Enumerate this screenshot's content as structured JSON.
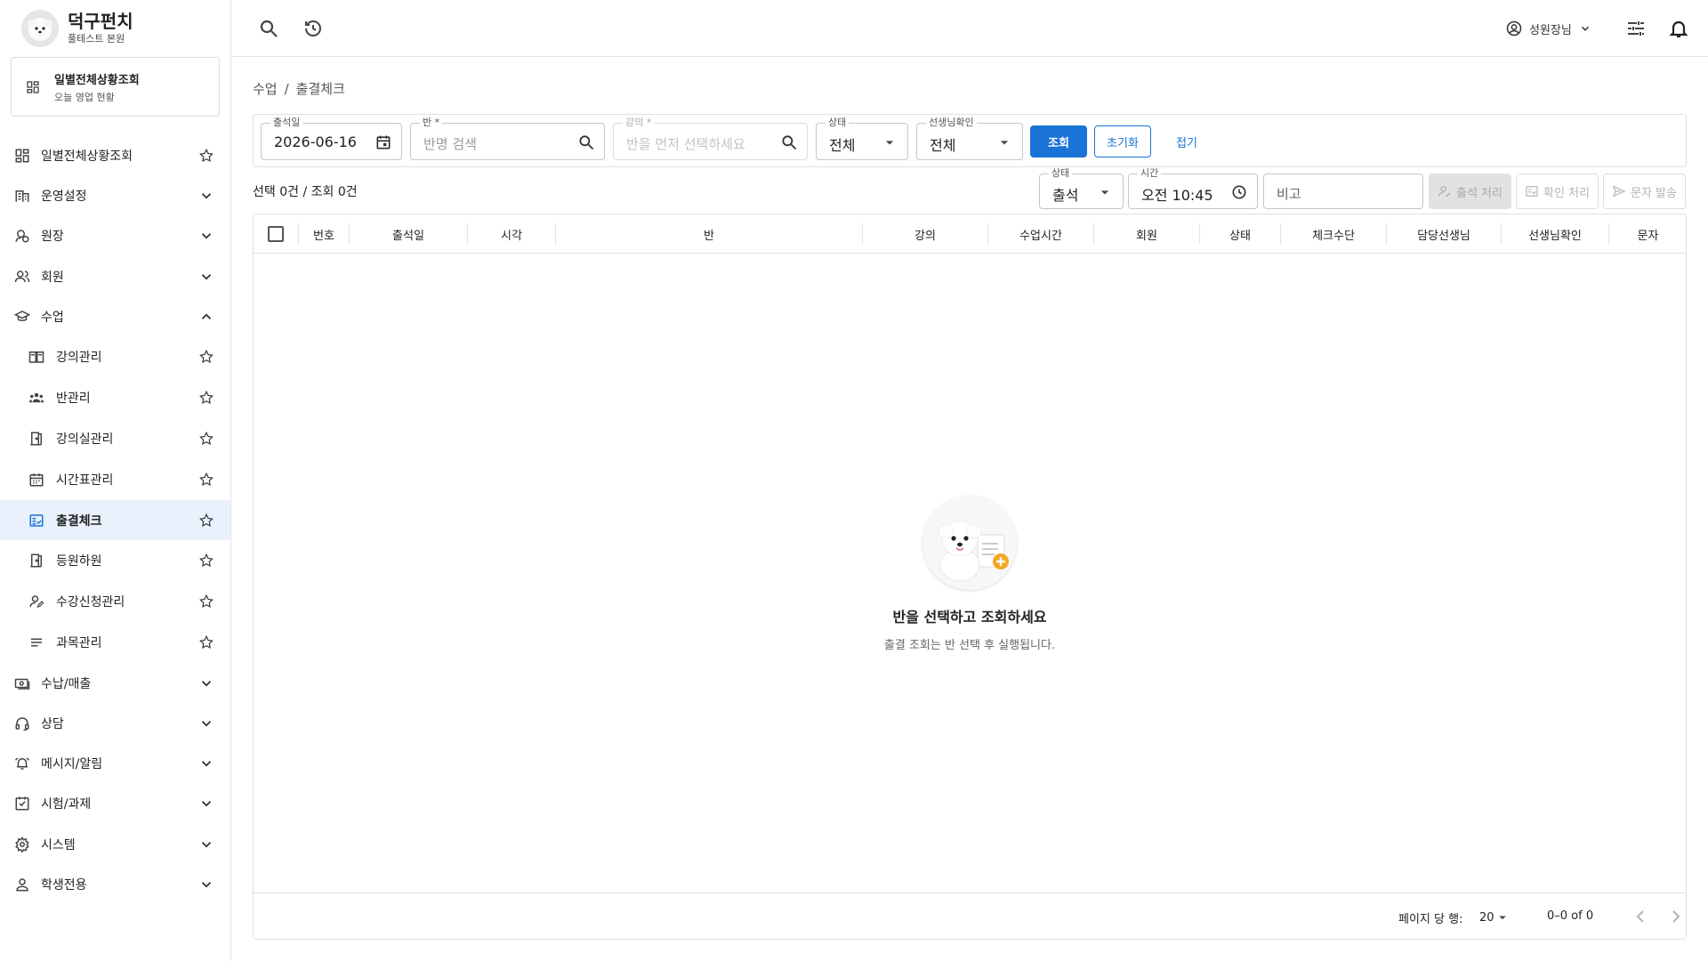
{
  "brand": {
    "name": "덕구펀치",
    "branch": "풀테스트 본원"
  },
  "today_card": {
    "title": "일별전체상황조회",
    "subtitle": "오늘 영업 현황"
  },
  "sidebar": {
    "items": [
      {
        "label": "일별전체상황조회",
        "icon": "dashboard-icon",
        "right": "star"
      },
      {
        "label": "운영설정",
        "icon": "building-icon",
        "right": "chevron-down"
      },
      {
        "label": "원장",
        "icon": "owner-icon",
        "right": "chevron-down"
      },
      {
        "label": "회원",
        "icon": "people-icon",
        "right": "chevron-down"
      },
      {
        "label": "수업",
        "icon": "graduation-cap-icon",
        "right": "chevron-up"
      },
      {
        "label": "강의관리",
        "icon": "book-icon",
        "right": "star",
        "sub": true
      },
      {
        "label": "반관리",
        "icon": "group-icon",
        "right": "star",
        "sub": true
      },
      {
        "label": "강의실관리",
        "icon": "door-icon",
        "right": "star",
        "sub": true
      },
      {
        "label": "시간표관리",
        "icon": "calendar-icon",
        "right": "star",
        "sub": true
      },
      {
        "label": "출결체크",
        "icon": "fact-check-icon",
        "right": "star",
        "sub": true,
        "active": true
      },
      {
        "label": "등원하원",
        "icon": "door-icon",
        "right": "star",
        "sub": true
      },
      {
        "label": "수강신청관리",
        "icon": "person-edit-icon",
        "right": "star",
        "sub": true
      },
      {
        "label": "과목관리",
        "icon": "list-icon",
        "right": "star",
        "sub": true
      },
      {
        "label": "수납/매출",
        "icon": "payments-icon",
        "right": "chevron-down"
      },
      {
        "label": "상담",
        "icon": "headset-icon",
        "right": "chevron-down"
      },
      {
        "label": "메시지/알림",
        "icon": "alarm-icon",
        "right": "chevron-down"
      },
      {
        "label": "시험/과제",
        "icon": "checkbox-icon",
        "right": "chevron-down"
      },
      {
        "label": "시스템",
        "icon": "gear-icon",
        "right": "chevron-down"
      },
      {
        "label": "학생전용",
        "icon": "person-icon",
        "right": "chevron-down"
      }
    ]
  },
  "topbar": {
    "user_label": "성원장님"
  },
  "breadcrumb": {
    "parent": "수업",
    "separator": "/",
    "current": "출결체크"
  },
  "filters": {
    "date": {
      "label": "출석일",
      "value": "2026-06-16"
    },
    "class": {
      "label": "반 *",
      "placeholder": "반명 검색"
    },
    "lecture": {
      "label": "강의 *",
      "placeholder": "반을 먼저 선택하세요"
    },
    "status": {
      "label": "상태",
      "value": "전체"
    },
    "teacher_check": {
      "label": "선생님확인",
      "value": "전체"
    },
    "search_button": "조회",
    "reset_button": "초기화",
    "collapse_button": "접기"
  },
  "counts": {
    "text": "선택 0건 / 조회 0건"
  },
  "bulk": {
    "status": {
      "label": "상태",
      "value": "출석"
    },
    "time": {
      "label": "시간",
      "value": "오전 10:45"
    },
    "note": {
      "placeholder": "비고"
    },
    "attend_button": "출석 처리",
    "confirm_button": "확인 처리",
    "sms_button": "문자 발송"
  },
  "table": {
    "columns": [
      "번호",
      "출석일",
      "시각",
      "반",
      "강의",
      "수업시간",
      "회원",
      "상태",
      "체크수단",
      "담당선생님",
      "선생님확인",
      "문자"
    ]
  },
  "empty": {
    "title": "반을 선택하고 조회하세요",
    "subtitle": "출결 조회는 반 선택 후 실행됩니다."
  },
  "pagination": {
    "rows_per_page_label": "페이지 당 행:",
    "rows_per_page": "20",
    "range": "0–0 of 0"
  },
  "colors": {
    "primary": "#1a73d6",
    "active_bg": "#e9f2fc",
    "border": "#e0e0e0"
  }
}
